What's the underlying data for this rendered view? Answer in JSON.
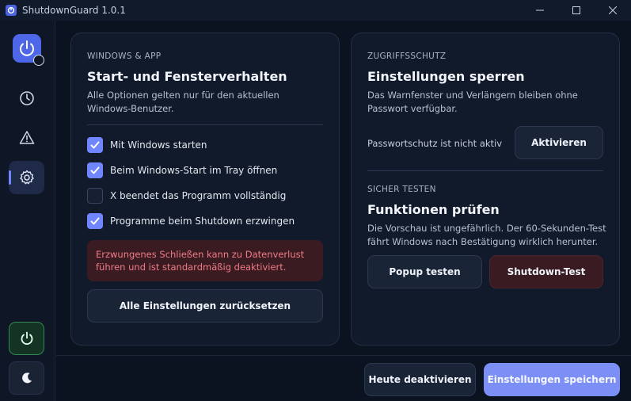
{
  "window": {
    "title": "ShutdownGuard 1.0.1"
  },
  "sidebar": {
    "items": [
      {
        "icon": "history-icon"
      },
      {
        "icon": "warning-icon"
      },
      {
        "icon": "gear-icon",
        "active": true
      }
    ],
    "power_icon": "power-icon",
    "theme_icon": "moon-icon"
  },
  "left_card": {
    "eyebrow": "WINDOWS & APP",
    "title": "Start- und Fensterverhalten",
    "description": "Alle Optionen gelten nur für den aktuellen Windows-Benutzer.",
    "options": [
      {
        "label": "Mit Windows starten",
        "checked": true
      },
      {
        "label": "Beim Windows-Start im Tray öffnen",
        "checked": true
      },
      {
        "label": "X beendet das Programm vollständig",
        "checked": false
      },
      {
        "label": "Programme beim Shutdown erzwingen",
        "checked": true
      }
    ],
    "warning": "Erzwungenes Schließen kann zu Datenverlust führen und ist standardmäßig deaktiviert.",
    "reset_button": "Alle Einstellungen zurücksetzen"
  },
  "right_card": {
    "lock_eyebrow": "ZUGRIFFSSCHUTZ",
    "lock_title": "Einstellungen sperren",
    "lock_description": "Das Warnfenster und Verlängern bleiben ohne Passwort verfügbar.",
    "password_status": "Passwortschutz ist nicht aktiv",
    "activate_button": "Aktivieren",
    "test_eyebrow": "SICHER TESTEN",
    "test_title": "Funktionen prüfen",
    "test_description": "Die Vorschau ist ungefährlich. Der 60-Sekunden-Test fährt Windows nach Bestätigung wirklich herunter.",
    "popup_button": "Popup testen",
    "shutdown_button": "Shutdown-Test"
  },
  "footer": {
    "disable_today_button": "Heute deaktivieren",
    "save_button": "Einstellungen speichern"
  },
  "colors": {
    "accent": "#6f86ff",
    "danger_bg": "#3a1b22",
    "danger_text": "#f07c86",
    "success": "#2f8a55"
  }
}
